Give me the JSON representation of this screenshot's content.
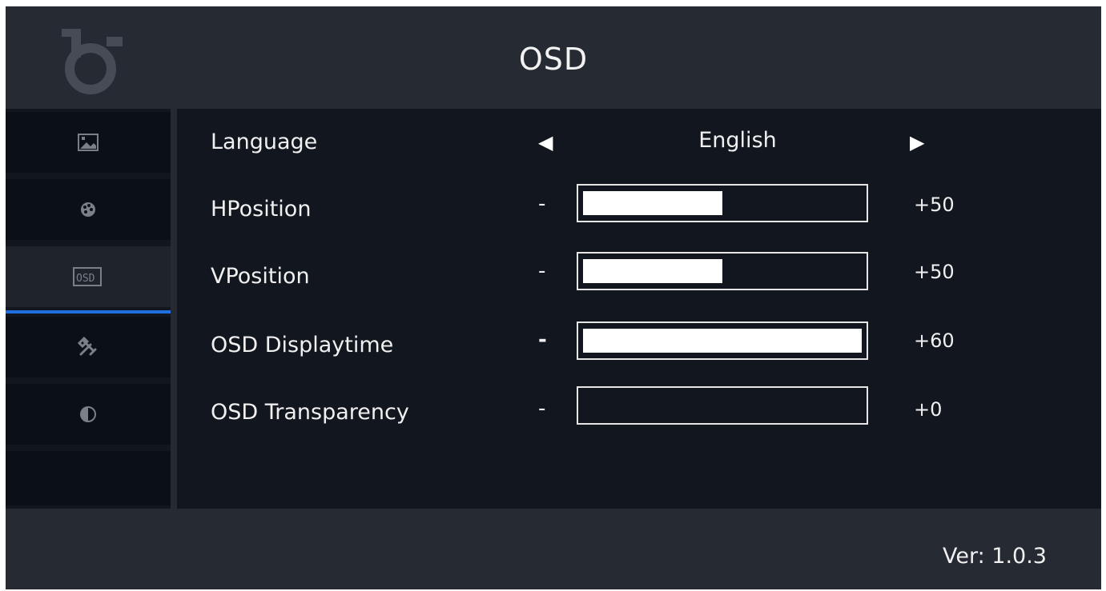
{
  "header": {
    "title": "OSD",
    "logo_icon": "monitor-brand-logo-icon"
  },
  "sidebar": {
    "items": [
      {
        "icon": "picture-icon"
      },
      {
        "icon": "color-palette-icon"
      },
      {
        "icon": "osd-icon",
        "icon_text": "OSD",
        "active": true
      },
      {
        "icon": "tools-icon"
      },
      {
        "icon": "contrast-icon"
      }
    ],
    "active_color": "#1f6fe0"
  },
  "settings": {
    "language": {
      "label": "Language",
      "value": "English",
      "left_arrow": "◀",
      "right_arrow": "▶"
    },
    "sliders": [
      {
        "label": "HPosition",
        "minus": "-",
        "value_text": "+50",
        "level": 0.5
      },
      {
        "label": "VPosition",
        "minus": "-",
        "value_text": "+50",
        "level": 0.5
      },
      {
        "label": "OSD Displaytime",
        "minus": "-",
        "value_text": "+60",
        "level": 1.0
      },
      {
        "label": "OSD Transparency",
        "minus": "-",
        "value_text": "+0",
        "level": 0.0
      }
    ]
  },
  "footer": {
    "version": "Ver: 1.0.3"
  }
}
